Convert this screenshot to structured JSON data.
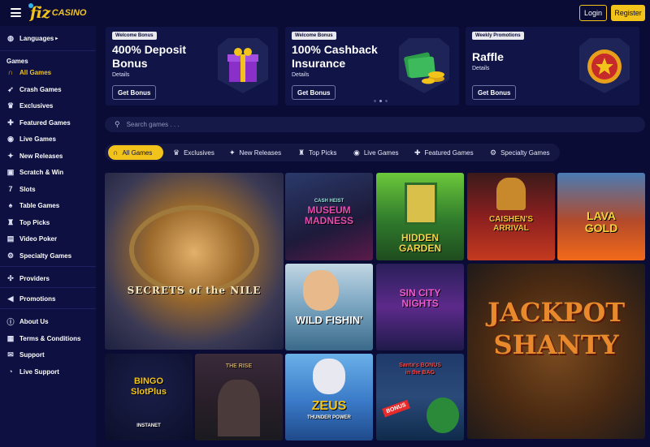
{
  "header": {
    "logo_main": "fiz",
    "logo_sub": "CASINO",
    "login_label": "Login",
    "register_label": "Register"
  },
  "sidebar": {
    "languages": "Languages",
    "games_heading": "Games",
    "games": [
      {
        "label": "All Games",
        "icon": "horseshoe-icon",
        "active": true
      },
      {
        "label": "Crash Games",
        "icon": "rocket-icon"
      },
      {
        "label": "Exclusives",
        "icon": "crown-icon"
      },
      {
        "label": "Featured Games",
        "icon": "puzzle-icon"
      },
      {
        "label": "Live Games",
        "icon": "live-icon"
      },
      {
        "label": "New Releases",
        "icon": "sparkle-icon"
      },
      {
        "label": "Scratch & Win",
        "icon": "scratch-icon"
      },
      {
        "label": "Slots",
        "icon": "seven-icon"
      },
      {
        "label": "Table Games",
        "icon": "cards-icon"
      },
      {
        "label": "Top Picks",
        "icon": "trophy-icon"
      },
      {
        "label": "Video Poker",
        "icon": "poker-icon"
      },
      {
        "label": "Specialty Games",
        "icon": "gear-icon"
      }
    ],
    "providers": "Providers",
    "promotions": "Promotions",
    "info": [
      {
        "label": "About Us",
        "icon": "info-icon"
      },
      {
        "label": "Terms & Conditions",
        "icon": "document-icon"
      },
      {
        "label": "Support",
        "icon": "mail-icon"
      },
      {
        "label": "Live Support",
        "icon": "chat-icon"
      }
    ]
  },
  "banners": [
    {
      "tag": "Welcome Bonus",
      "title_line1": "400% Deposit",
      "title_line2": "Bonus",
      "details": "Details",
      "button": "Get Bonus",
      "art": "gift-box"
    },
    {
      "tag": "Welcome Bonus",
      "title_line1": "100% Cashback",
      "title_line2": "Insurance",
      "details": "Details",
      "button": "Get Bonus",
      "art": "money-stack"
    },
    {
      "tag": "Weekly Promotions",
      "title_line1": "Raffle",
      "title_line2": "",
      "details": "Details",
      "button": "Get Bonus",
      "art": "star-medal"
    }
  ],
  "search": {
    "placeholder": "Search games . . ."
  },
  "categories": [
    {
      "label": "All Games",
      "icon": "horseshoe-icon",
      "active": true
    },
    {
      "label": "Exclusives",
      "icon": "crown-icon"
    },
    {
      "label": "New Releases",
      "icon": "sparkle-icon"
    },
    {
      "label": "Top Picks",
      "icon": "trophy-icon"
    },
    {
      "label": "Live Games",
      "icon": "live-icon"
    },
    {
      "label": "Featured Games",
      "icon": "puzzle-icon"
    },
    {
      "label": "Specialty Games",
      "icon": "gear-icon"
    }
  ],
  "games": [
    {
      "title": "SECRETS of the NILE"
    },
    {
      "title": "MUSEUM MADNESS",
      "kicker": "CASH HEIST"
    },
    {
      "title": "HIDDEN GARDEN"
    },
    {
      "title": "CAISHEN'S ARRIVAL"
    },
    {
      "title": "LAVA GOLD"
    },
    {
      "title": "WILD FISHIN'"
    },
    {
      "title": "SIN CITY NIGHTS"
    },
    {
      "title": "JACKPOT SHANTY"
    },
    {
      "title": "BINGO SlotPlus",
      "badge": "INSTANET"
    },
    {
      "title": "THE RISE"
    },
    {
      "title": "ZEUS",
      "subtitle": "THUNDER POWER"
    },
    {
      "title": "Santa's BONUS in the BAG",
      "badge": "BONUS"
    }
  ]
}
